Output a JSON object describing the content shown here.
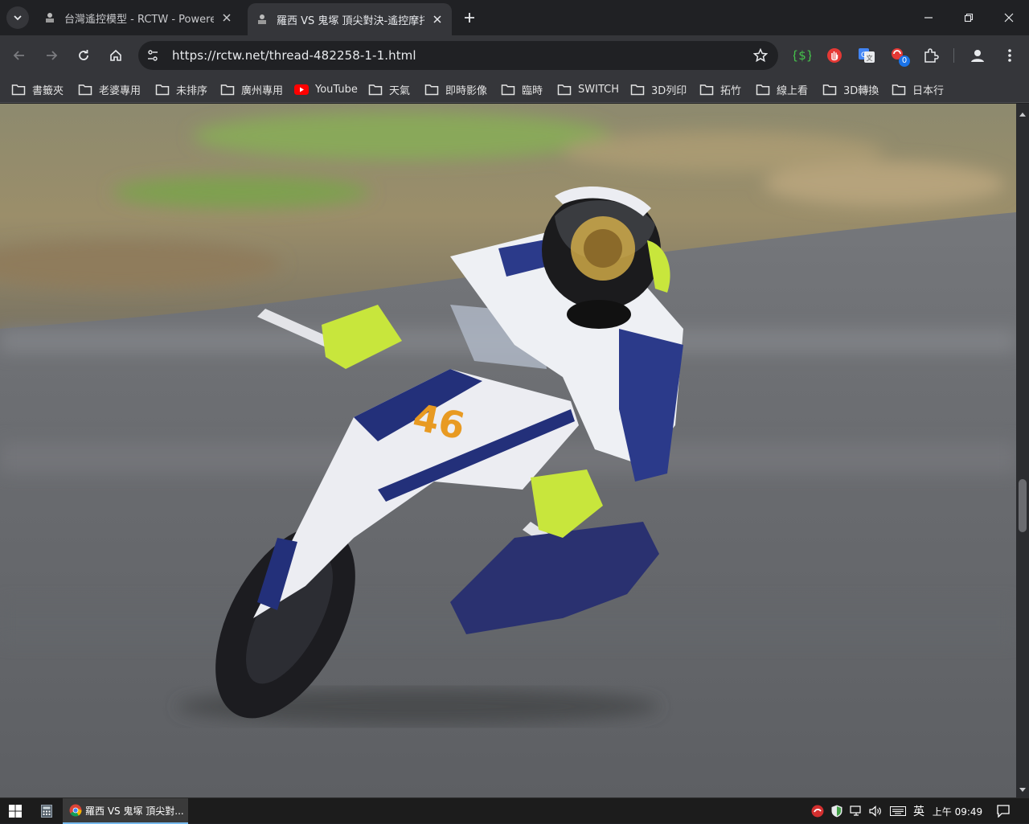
{
  "tabs": [
    {
      "title": "台灣遙控模型 - RCTW - Powered",
      "active": false
    },
    {
      "title": "羅西 VS 鬼塚 頂尖對決-遙控摩托車",
      "active": true
    }
  ],
  "url": "https://rctw.net/thread-482258-1-1.html",
  "bookmarks": [
    {
      "label": "書籤夾",
      "icon": "folder-icon"
    },
    {
      "label": "老婆專用",
      "icon": "folder-icon"
    },
    {
      "label": "未排序",
      "icon": "folder-icon"
    },
    {
      "label": "廣州專用",
      "icon": "folder-icon"
    },
    {
      "label": "YouTube",
      "icon": "youtube-icon"
    },
    {
      "label": "天氣",
      "icon": "folder-icon"
    },
    {
      "label": "即時影像",
      "icon": "folder-icon"
    },
    {
      "label": "臨時",
      "icon": "folder-icon"
    },
    {
      "label": "SWITCH",
      "icon": "folder-icon"
    },
    {
      "label": "3D列印",
      "icon": "folder-icon"
    },
    {
      "label": "拓竹",
      "icon": "folder-icon"
    },
    {
      "label": "線上看",
      "icon": "folder-icon"
    },
    {
      "label": "3D轉換",
      "icon": "folder-icon"
    },
    {
      "label": "日本行",
      "icon": "folder-icon"
    }
  ],
  "extensions": {
    "badge_count": "0"
  },
  "photo": {
    "bike_number": "46"
  },
  "taskbar": {
    "app_title": "羅西 VS 鬼塚 頂尖對...",
    "ime": "英",
    "clock": "上午 09:49"
  },
  "colors": {
    "accent": "#8ab4f8",
    "helmet_yellow": "#c8e63c",
    "bike_blue": "#23307a"
  }
}
